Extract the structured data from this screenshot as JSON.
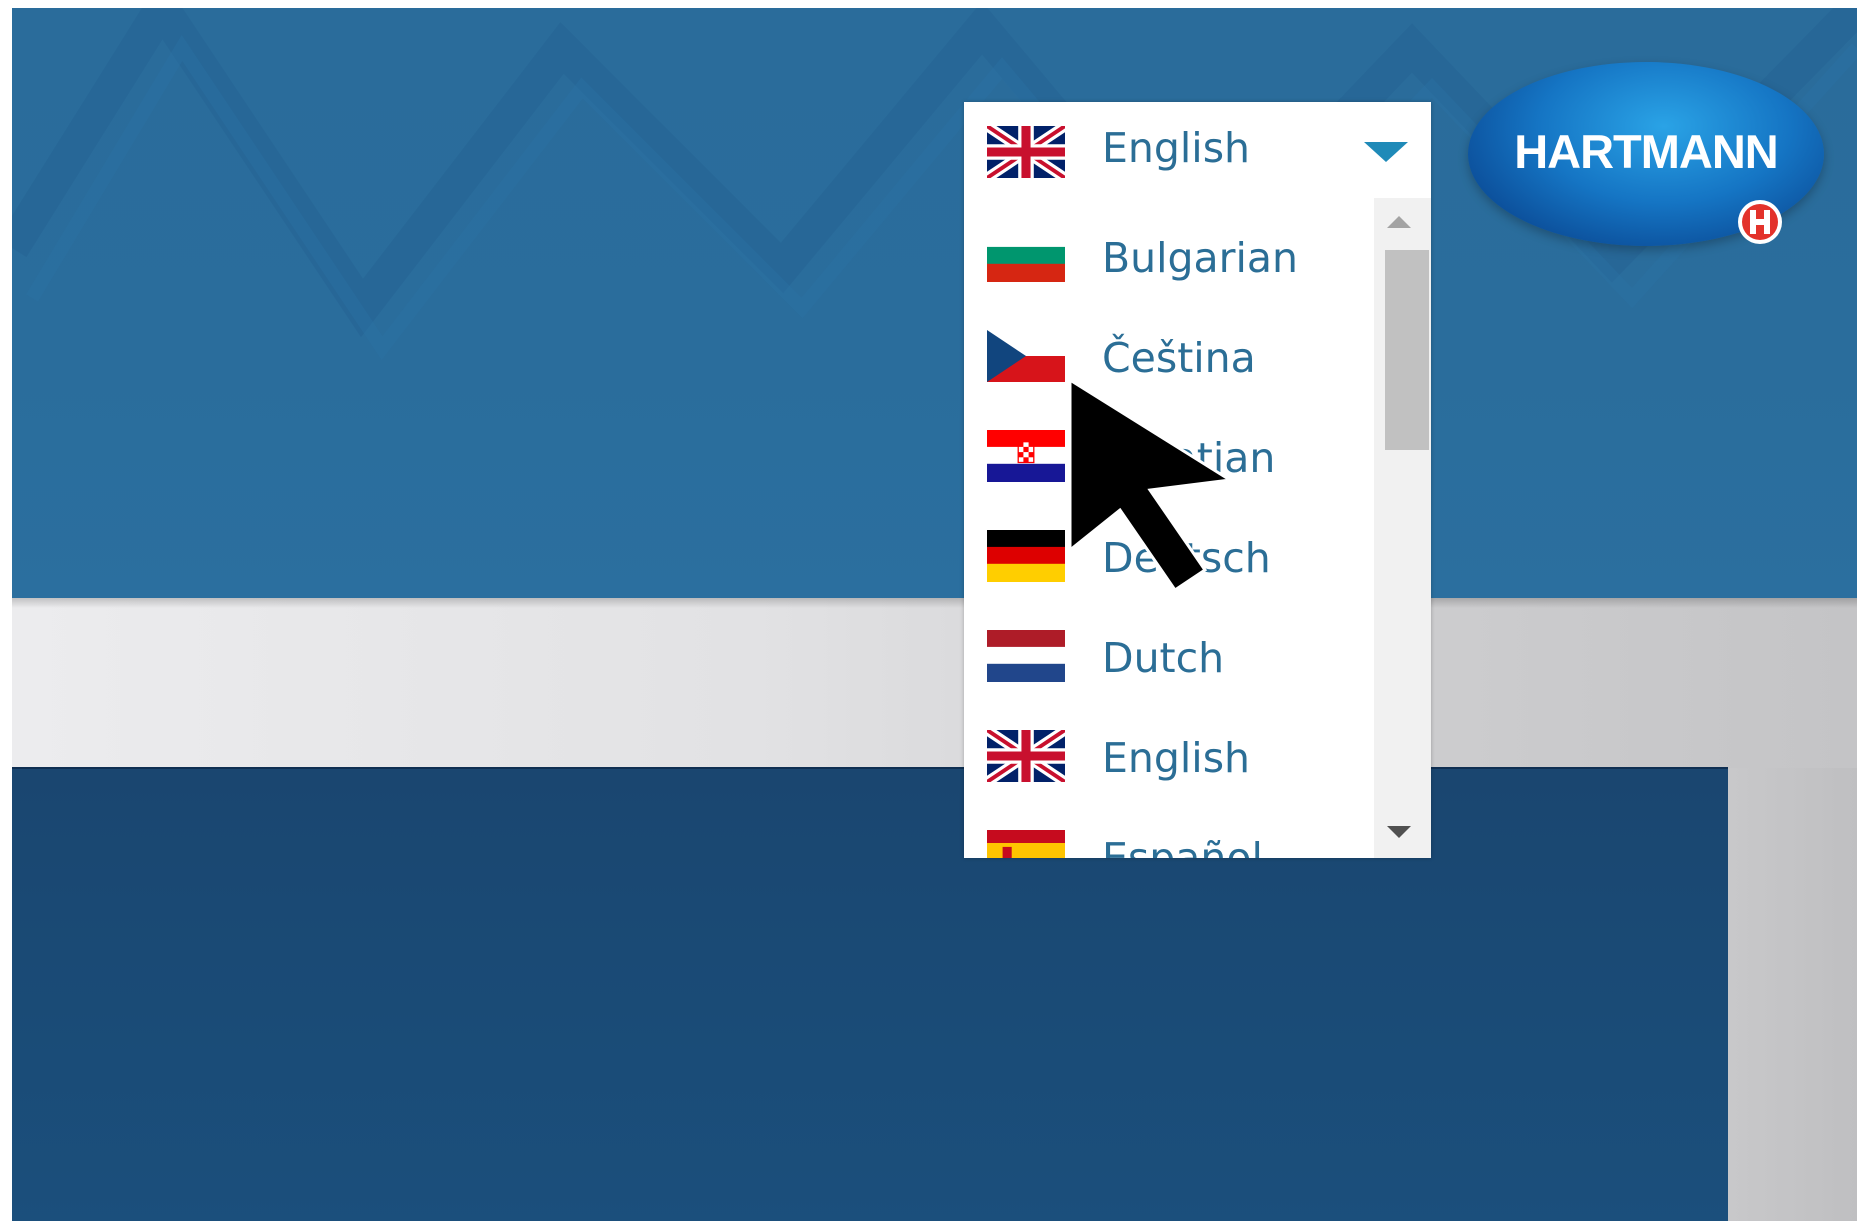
{
  "header": {
    "logo": {
      "brand": "HARTMANN",
      "colors": {
        "primary": "#1575c4",
        "dark": "#093e82",
        "mark": "#e3322b"
      }
    }
  },
  "language_dropdown": {
    "selected": {
      "label": "English",
      "flag": "uk-flag-icon"
    },
    "caret_icon": "caret-down-icon",
    "options": [
      {
        "label": "Bulgarian",
        "flag": "bulgaria-flag-icon"
      },
      {
        "label": "Čeština",
        "flag": "czech-flag-icon"
      },
      {
        "label": "Croatian",
        "flag": "croatia-flag-icon"
      },
      {
        "label": "Deutsch",
        "flag": "germany-flag-icon"
      },
      {
        "label": "Dutch",
        "flag": "netherlands-flag-icon"
      },
      {
        "label": "English",
        "flag": "uk-flag-icon"
      },
      {
        "label": "Español",
        "flag": "spain-flag-icon"
      }
    ],
    "scroll_up_icon": "scroll-up-arrow-icon",
    "scroll_down_icon": "scroll-down-arrow-icon"
  },
  "theme": {
    "header_blue": "#2a6c9b",
    "panel_blue": "#1a4a75",
    "label_color": "#2b6e96",
    "caret_color": "#1f8ab8"
  }
}
